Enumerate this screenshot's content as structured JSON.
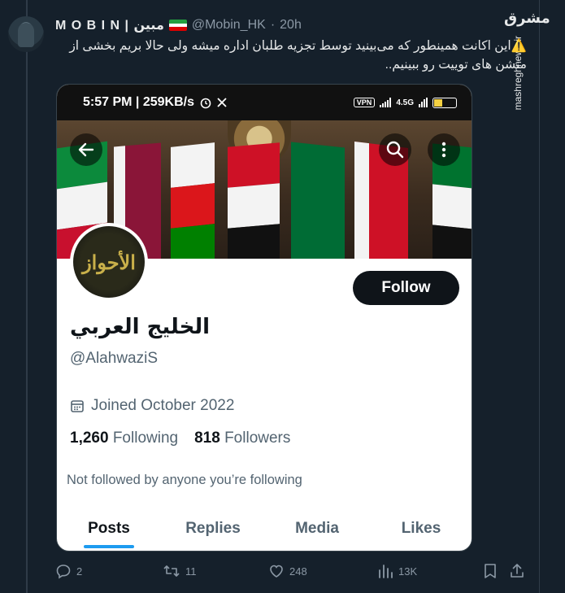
{
  "author": {
    "name": "M O B I N | مبین",
    "handle": "@Mobin_HK",
    "separator": "·",
    "time": "20h",
    "flag_colors": [
      "#239f40",
      "#ffffff",
      "#da0000"
    ]
  },
  "tweet": {
    "warning_icon": "⚠️",
    "text": "این اکانت همینطور که می‌بینید توسط تجزیه طلبان اداره میشه ولی حالا بریم بخشی از منشن های توییت رو ببینیم.."
  },
  "watermark": {
    "logo": "مشرق",
    "site": "mashreghnews.ir"
  },
  "screenshot": {
    "status_time": "5:57 PM | 259KB/s",
    "network": "4.5G",
    "vpn": "VPN",
    "battery": "51",
    "profile": {
      "display_name": "الخليج العربي",
      "handle": "@AlahwaziS",
      "joined": "Joined October 2022",
      "following_count": "1,260",
      "following_label": "Following",
      "followers_count": "818",
      "followers_label": "Followers",
      "not_followed": "Not followed by anyone you’re following",
      "follow_button": "Follow",
      "avatar_text": "الأحواز"
    },
    "tabs": [
      "Posts",
      "Replies",
      "Media",
      "Likes"
    ],
    "active_tab": "Posts"
  },
  "actions": {
    "replies": "2",
    "retweets": "11",
    "likes": "248",
    "views": "13K"
  },
  "colors": {
    "background": "#15202b",
    "accent": "#1d9bf0",
    "muted": "#8b98a5"
  }
}
